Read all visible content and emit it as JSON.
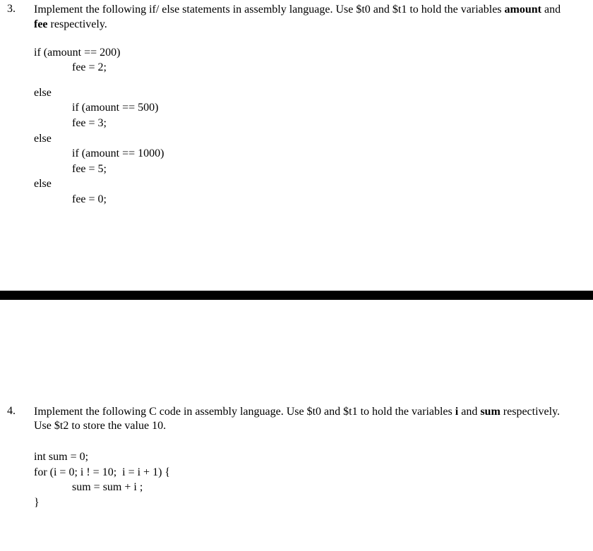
{
  "q3": {
    "number": "3.",
    "prompt_part1": "Implement the following if/ else statements in assembly language. Use $t0  and  $t1 to hold the variables ",
    "prompt_bold1": "amount",
    "prompt_part2": " and  ",
    "prompt_bold2": "fee",
    "prompt_part3": " respectively.",
    "code": {
      "l1": "if (amount == 200)",
      "l2": "fee = 2;",
      "l3": "else",
      "l4": "if (amount == 500)",
      "l5": "fee = 3;",
      "l6": "else",
      "l7": "if (amount == 1000)",
      "l8": "fee = 5;",
      "l9": "else",
      "l10": "fee = 0;"
    }
  },
  "q4": {
    "number": "4.",
    "prompt_part1": "Implement  the  following C code in assembly language. Use $t0 and $t1 to hold the variables ",
    "prompt_bold1": "i",
    "prompt_part2": " and ",
    "prompt_bold2": "sum",
    "prompt_part3": " respectively. Use $t2 to store the value 10.",
    "code": {
      "l1": "int sum = 0;",
      "l2": "for (i = 0; i ! = 10;  i = i + 1) {",
      "l3": "sum = sum + i ;",
      "l4": "}"
    }
  }
}
